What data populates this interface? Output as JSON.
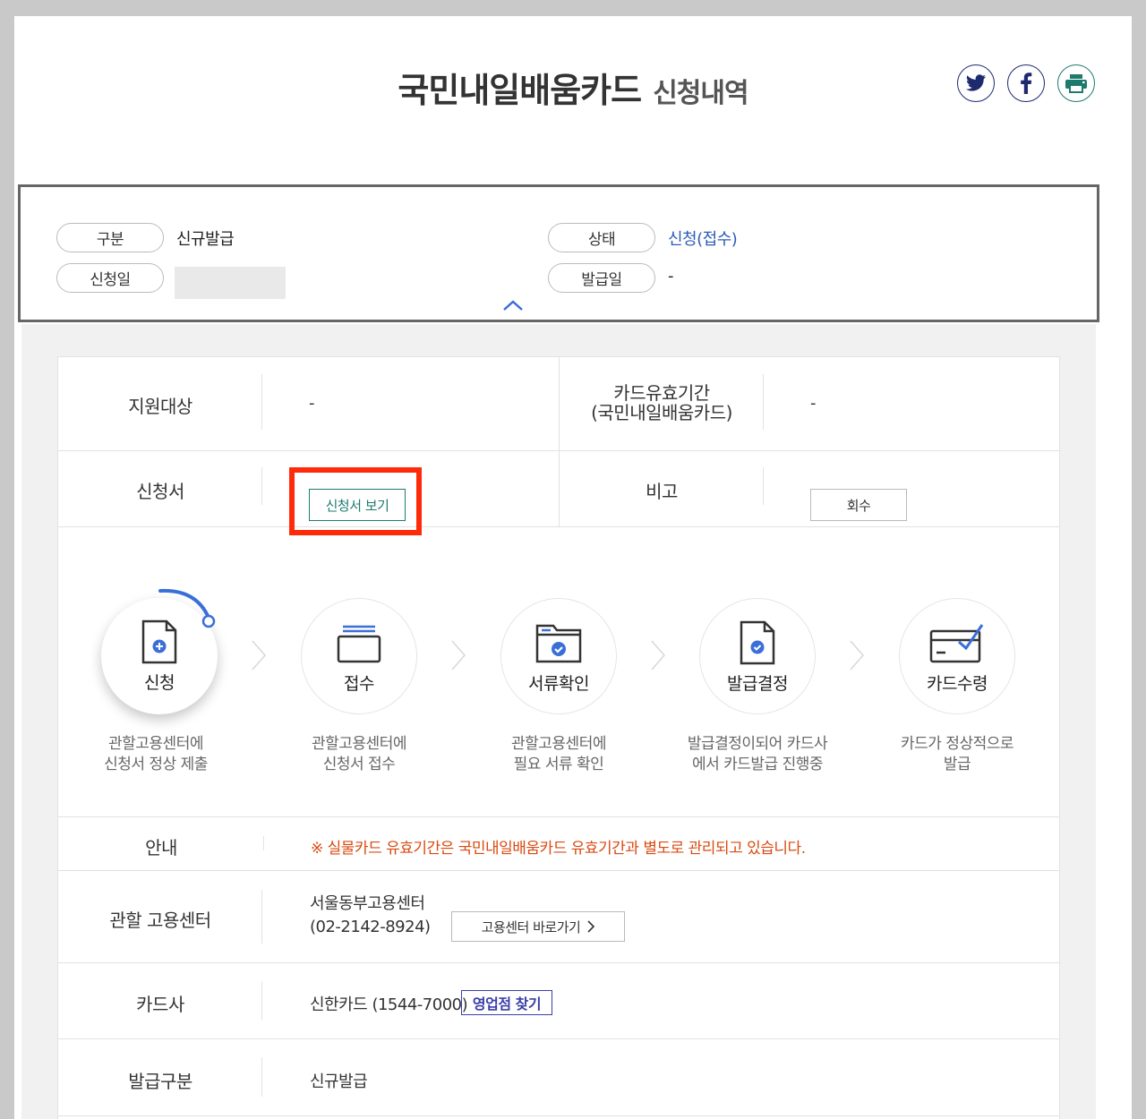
{
  "header": {
    "title_main": "국민내일배움카드",
    "title_sub": "신청내역",
    "share": [
      "twitter-icon",
      "facebook-icon",
      "print-icon"
    ]
  },
  "summary": {
    "type_label": "구분",
    "type_value": "신규발급",
    "status_label": "상태",
    "status_value": "신청(접수)",
    "apply_date_label": "신청일",
    "issue_date_label": "발급일",
    "issue_date_value": "-"
  },
  "details": {
    "support_label": "지원대상",
    "support_value": "-",
    "validity_label_1": "카드유효기간",
    "validity_label_2": "(국민내일배움카드)",
    "validity_value": "-",
    "application_label": "신청서",
    "application_button": "신청서 보기",
    "remark_label": "비고",
    "remark_button": "회수"
  },
  "steps": [
    {
      "name": "신청",
      "desc1": "관할고용센터에",
      "desc2": "신청서 정상 제출",
      "icon": "document-plus-icon"
    },
    {
      "name": "접수",
      "desc1": "관할고용센터에",
      "desc2": "신청서 접수",
      "icon": "inbox-icon"
    },
    {
      "name": "서류확인",
      "desc1": "관할고용센터에",
      "desc2": "필요 서류 확인",
      "icon": "folder-check-icon"
    },
    {
      "name": "발급결정",
      "desc1": "발급결정이되어 카드사",
      "desc2": "에서 카드발급 진행중",
      "icon": "document-check-icon"
    },
    {
      "name": "카드수령",
      "desc1": "카드가 정상적으로",
      "desc2": "발급",
      "icon": "card-check-icon"
    }
  ],
  "info": {
    "notice_label": "안내",
    "notice_text": "※ 실물카드 유효기간은 국민내일배움카드 유효기간과 별도로 관리되고 있습니다.",
    "center_label": "관할 고용센터",
    "center_name": "서울동부고용센터",
    "center_phone": "(02-2142-8924)",
    "center_button": "고용센터 바로가기",
    "card_company_label": "카드사",
    "card_company_value": "신한카드 (1544-7000)",
    "branch_button": "영업점 찾기",
    "issue_type_label": "발급구분",
    "issue_type_value": "신규발급"
  },
  "colors": {
    "accent_blue": "#2d5bb7",
    "teal": "#1f7a6e",
    "notice_orange": "#d94a10",
    "highlight_red": "#ff2a0a",
    "navy": "#1e2a6e"
  }
}
